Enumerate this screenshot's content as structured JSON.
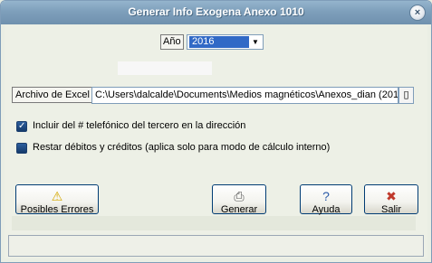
{
  "window": {
    "title": "Generar Info Exogena Anexo 1010"
  },
  "year": {
    "label": "Año",
    "selected": "2016"
  },
  "excel": {
    "label": "Archivo de Excel",
    "path": "C:\\Users\\dalcalde\\Documents\\Medios magnéticos\\Anexos_dian (201"
  },
  "options": {
    "include_phone": {
      "label": "Incluir del # telefónico del tercero en la dirección",
      "checked": true
    },
    "subtract": {
      "label": "Restar débitos y créditos (aplica solo para modo de cálculo interno)",
      "checked": false
    }
  },
  "buttons": {
    "errors": "Posibles Errores",
    "generate": "Generar",
    "help": "Ayuda",
    "exit": "Salir"
  },
  "icons": {
    "close": "close-icon",
    "warning": "warning-icon",
    "printer": "printer-icon",
    "help": "help-icon",
    "exit": "exit-icon",
    "browse": "browse-icon"
  }
}
